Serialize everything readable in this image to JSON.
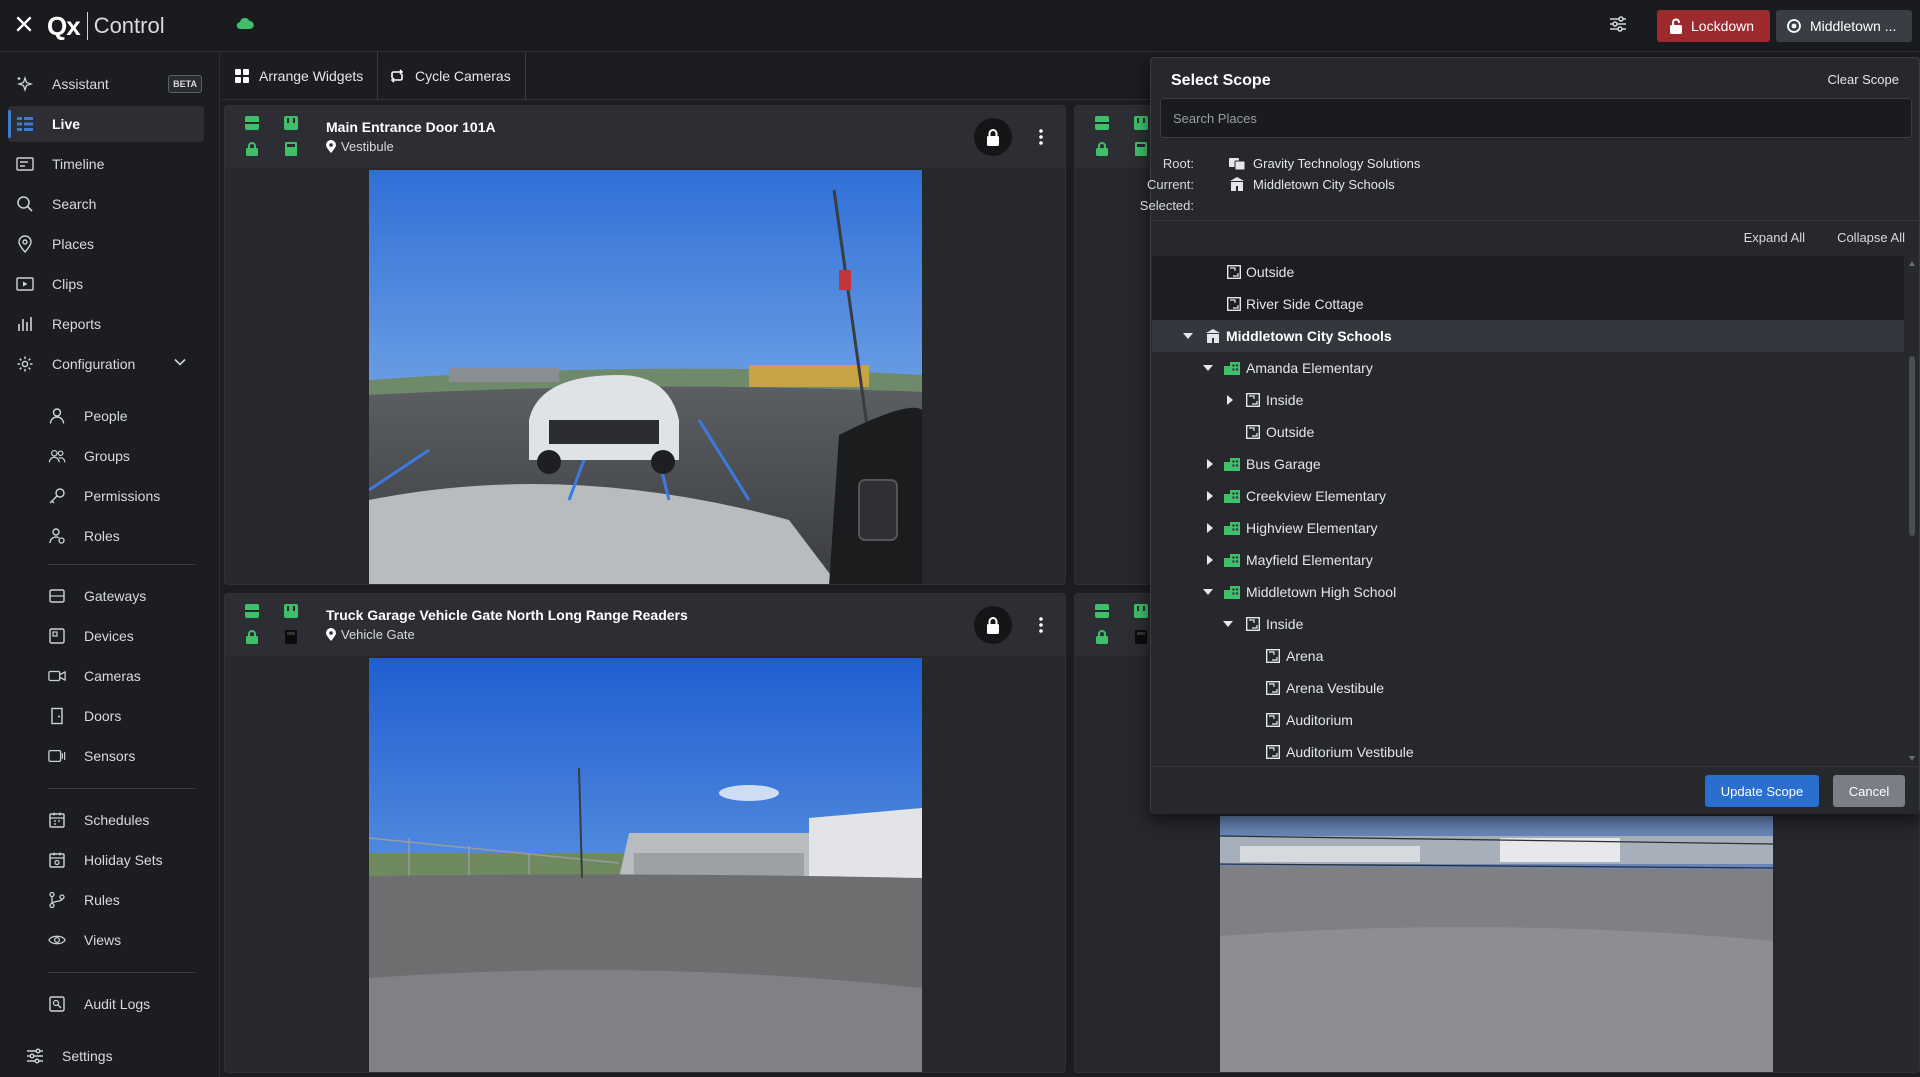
{
  "app": {
    "logo": "Qx",
    "product": "Control"
  },
  "topbar": {
    "lockdown_label": "Lockdown",
    "scope_label": "Middletown ..."
  },
  "sidebar": {
    "items": [
      {
        "label": "Assistant",
        "badge": "BETA"
      },
      {
        "label": "Live"
      },
      {
        "label": "Timeline"
      },
      {
        "label": "Search"
      },
      {
        "label": "Places"
      },
      {
        "label": "Clips"
      },
      {
        "label": "Reports"
      },
      {
        "label": "Configuration"
      }
    ],
    "config_items": [
      {
        "label": "People"
      },
      {
        "label": "Groups"
      },
      {
        "label": "Permissions"
      },
      {
        "label": "Roles"
      },
      {
        "label": "Gateways"
      },
      {
        "label": "Devices"
      },
      {
        "label": "Cameras"
      },
      {
        "label": "Doors"
      },
      {
        "label": "Sensors"
      },
      {
        "label": "Schedules"
      },
      {
        "label": "Holiday Sets"
      },
      {
        "label": "Rules"
      },
      {
        "label": "Views"
      },
      {
        "label": "Audit Logs"
      }
    ],
    "settings_label": "Settings"
  },
  "toolbar": {
    "arrange_label": "Arrange Widgets",
    "cycle_label": "Cycle Cameras"
  },
  "tiles": [
    {
      "title": "Main Entrance Door 101A",
      "location": "Vestibule"
    },
    {
      "title": "Truck Garage Vehicle Gate North Long Range Readers",
      "location": "Vehicle Gate"
    }
  ],
  "scope_panel": {
    "title": "Select Scope",
    "clear_label": "Clear Scope",
    "search_placeholder": "Search Places",
    "root_label": "Root:",
    "root_value": "Gravity Technology Solutions",
    "current_label": "Current:",
    "current_value": "Middletown City Schools",
    "selected_label": "Selected:",
    "expand_all": "Expand All",
    "collapse_all": "Collapse All",
    "tree": [
      {
        "label": "Outside"
      },
      {
        "label": "River Side Cottage"
      },
      {
        "label": "Middletown City Schools"
      },
      {
        "label": "Amanda Elementary"
      },
      {
        "label": "Inside"
      },
      {
        "label": "Outside"
      },
      {
        "label": "Bus Garage"
      },
      {
        "label": "Creekview Elementary"
      },
      {
        "label": "Highview Elementary"
      },
      {
        "label": "Mayfield Elementary"
      },
      {
        "label": "Middletown High School"
      },
      {
        "label": "Inside"
      },
      {
        "label": "Arena"
      },
      {
        "label": "Arena Vestibule"
      },
      {
        "label": "Auditorium"
      },
      {
        "label": "Auditorium Vestibule"
      }
    ],
    "update_label": "Update Scope",
    "cancel_label": "Cancel"
  },
  "colors": {
    "accent": "#3a7bd5",
    "lockdown": "#9c2a2f",
    "status_green": "#3fbf6a",
    "update": "#2a6fd0"
  }
}
